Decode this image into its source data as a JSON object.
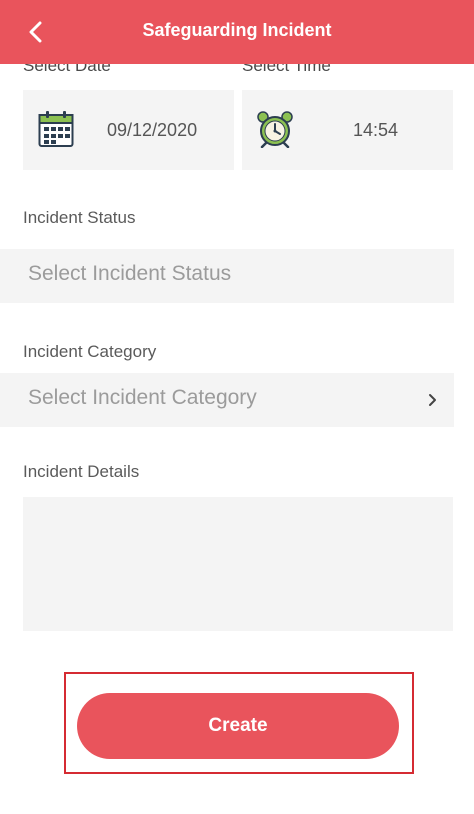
{
  "header": {
    "title": "Safeguarding Incident",
    "back_icon": "chevron-left-icon"
  },
  "date": {
    "label": "Select Date",
    "value": "09/12/2020",
    "icon": "calendar-icon"
  },
  "time": {
    "label": "Select Time",
    "value": "14:54",
    "icon": "alarm-clock-icon"
  },
  "status": {
    "label": "Incident Status",
    "placeholder": "Select Incident Status"
  },
  "category": {
    "label": "Incident Category",
    "placeholder": "Select Incident Category",
    "icon": "chevron-right-icon"
  },
  "details": {
    "label": "Incident Details",
    "value": ""
  },
  "actions": {
    "create_label": "Create"
  },
  "colors": {
    "brand": "#e9545c",
    "field_bg": "#f4f4f4",
    "highlight_border": "#d52b32"
  }
}
